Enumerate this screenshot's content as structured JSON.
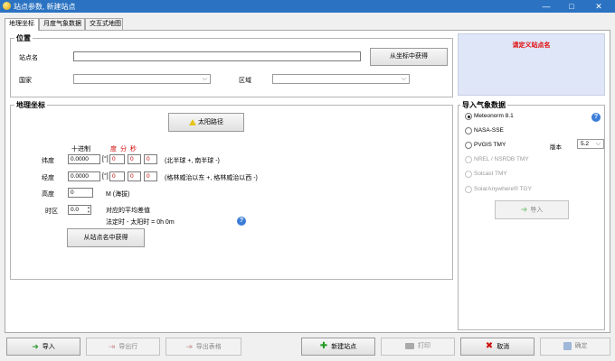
{
  "window": {
    "title": "站点参数, 新建站点",
    "minimize": "—",
    "maximize": "□",
    "close": "✕"
  },
  "tabs": [
    {
      "label": "地理坐标",
      "active": true
    },
    {
      "label": "月度气象数据",
      "active": false
    },
    {
      "label": "交互式地图",
      "active": false
    }
  ],
  "location": {
    "title": "位置",
    "site_name_label": "站点名",
    "site_name_value": "",
    "get_from_coords_button": "从坐标中获得",
    "country_label": "国家",
    "country_value": "",
    "region_label": "区域",
    "region_value": ""
  },
  "define_site_notice": "请定义站点名",
  "coords": {
    "title": "地理坐标",
    "sun_path_button": "太阳路径",
    "decimal_header": "十进制",
    "dms_header": "度 分 秒",
    "latitude": {
      "label": "纬度",
      "decimal": "0.0000",
      "unit": "[°]",
      "deg": "0",
      "min": "0",
      "sec": "0",
      "hint": "(北半球 +,  南半球 -)"
    },
    "longitude": {
      "label": "经度",
      "decimal": "0.0000",
      "unit": "[°]",
      "deg": "0",
      "min": "0",
      "sec": "0",
      "hint": "(格林威治以东 +,  格林威治以西 -)"
    },
    "altitude": {
      "label": "高度",
      "value": "0",
      "unit": "M (海拔)"
    },
    "timezone": {
      "label": "时区",
      "value": "0.0",
      "note1": "对应的平均差值",
      "note2": "法定时 - 太阳时 =   0h  0m"
    },
    "get_from_site_name_button": "从站点名中获得"
  },
  "meteo": {
    "title": "导入气象数据",
    "options": [
      {
        "label": "Meteonorm 8.1",
        "checked": true,
        "enabled": true
      },
      {
        "label": "NASA-SSE",
        "checked": false,
        "enabled": true
      },
      {
        "label": "PVGIS TMY",
        "checked": false,
        "enabled": true
      },
      {
        "label": "NREL / NSRDB TMY",
        "checked": false,
        "enabled": false
      },
      {
        "label": "Solcast TMY",
        "checked": false,
        "enabled": false
      },
      {
        "label": "SolarAnywhere® TGY",
        "checked": false,
        "enabled": false
      }
    ],
    "version_label": "版本",
    "version_value": "5.2",
    "import_button": "导入"
  },
  "footer": {
    "import": "导入",
    "export_row": "导出行",
    "export_table": "导出表格",
    "new_site": "新建站点",
    "print": "打印",
    "cancel": "取消",
    "ok": "确定"
  },
  "colors": {
    "titlebar": "#2b73c2",
    "notice_bg": "#dfe6f8",
    "notice_text": "#e00000",
    "dms_header": "#d00000"
  }
}
